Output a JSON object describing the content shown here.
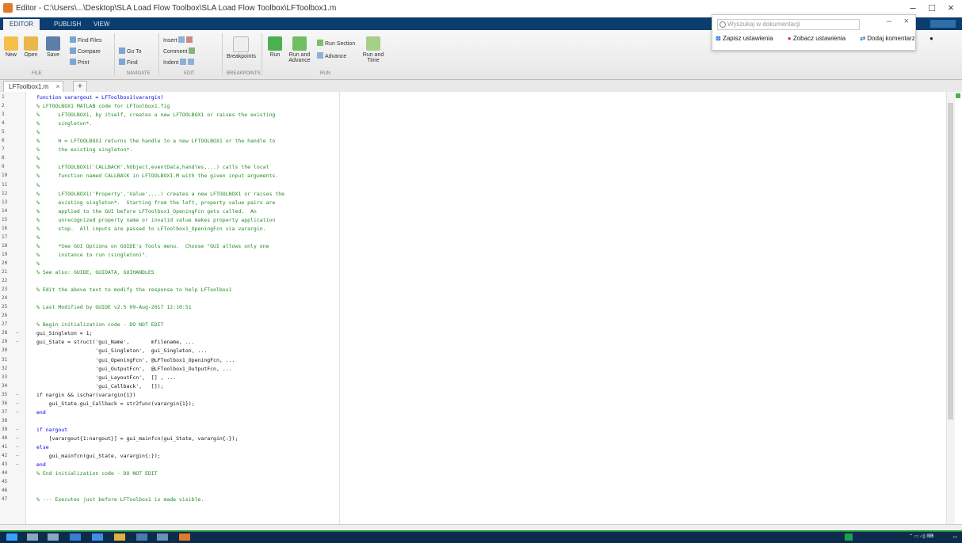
{
  "window": {
    "title": "Editor - C:\\Users\\...\\Desktop\\SLA Load Flow Toolbox\\SLA Load Flow Toolbox\\LFToolbox1.m"
  },
  "popup": {
    "search_placeholder": "Wyszukaj w dokumentacji",
    "items": [
      "Zapisz ustawienia",
      "Zobacz ustawienia",
      "Dodaj komentarz"
    ]
  },
  "ribbon": {
    "tabs": [
      "EDITOR",
      "PUBLISH",
      "VIEW"
    ],
    "new": "New",
    "open": "Open",
    "save": "Save",
    "find_files": "Find Files",
    "compare": "Compare",
    "print": "Print",
    "insert": "Insert",
    "comment": "Comment",
    "indent": "Indent",
    "go_to": "Go To",
    "find": "Find",
    "breakpoints": "Breakpoints",
    "run": "Run",
    "run_and_advance": "Run and Advance",
    "run_section": "Run Section",
    "advance": "Advance",
    "run_and_time": "Run and Time",
    "sections": [
      "FILE",
      "NAVIGATE",
      "EDIT",
      "BREAKPOINTS",
      "RUN"
    ]
  },
  "file_tab": {
    "name": "LFToolbox1.m",
    "close": "×",
    "add": "+"
  },
  "editor": {
    "lines": [
      {
        "n": "1",
        "mk": "",
        "cls": "kw",
        "text": "function varargout = LFToolbox1(varargin)"
      },
      {
        "n": "2",
        "mk": "",
        "cls": "cm",
        "text": "% LFTOOLBOX1 MATLAB code for LFToolbox1.fig"
      },
      {
        "n": "3",
        "mk": "",
        "cls": "cm",
        "text": "%      LFTOOLBOX1, by itself, creates a new LFTOOLBOX1 or raises the existing"
      },
      {
        "n": "4",
        "mk": "",
        "cls": "cm",
        "text": "%      singleton*."
      },
      {
        "n": "5",
        "mk": "",
        "cls": "cm",
        "text": "%"
      },
      {
        "n": "6",
        "mk": "",
        "cls": "cm",
        "text": "%      H = LFTOOLBOX1 returns the handle to a new LFTOOLBOX1 or the handle to"
      },
      {
        "n": "7",
        "mk": "",
        "cls": "cm",
        "text": "%      the existing singleton*."
      },
      {
        "n": "8",
        "mk": "",
        "cls": "cm",
        "text": "%"
      },
      {
        "n": "9",
        "mk": "",
        "cls": "cm",
        "text": "%      LFTOOLBOX1('CALLBACK',hObject,eventData,handles,...) calls the local"
      },
      {
        "n": "10",
        "mk": "",
        "cls": "cm",
        "text": "%      function named CALLBACK in LFTOOLBOX1.M with the given input arguments."
      },
      {
        "n": "11",
        "mk": "",
        "cls": "cm",
        "text": "%"
      },
      {
        "n": "12",
        "mk": "",
        "cls": "cm",
        "text": "%      LFTOOLBOX1('Property','Value',...) creates a new LFTOOLBOX1 or raises the"
      },
      {
        "n": "13",
        "mk": "",
        "cls": "cm",
        "text": "%      existing singleton*.  Starting from the left, property value pairs are"
      },
      {
        "n": "14",
        "mk": "",
        "cls": "cm",
        "text": "%      applied to the GUI before LFToolbox1_OpeningFcn gets called.  An"
      },
      {
        "n": "15",
        "mk": "",
        "cls": "cm",
        "text": "%      unrecognized property name or invalid value makes property application"
      },
      {
        "n": "16",
        "mk": "",
        "cls": "cm",
        "text": "%      stop.  All inputs are passed to LFToolbox1_OpeningFcn via varargin."
      },
      {
        "n": "17",
        "mk": "",
        "cls": "cm",
        "text": "%"
      },
      {
        "n": "18",
        "mk": "",
        "cls": "cm",
        "text": "%      *See GUI Options on GUIDE's Tools menu.  Choose \"GUI allows only one"
      },
      {
        "n": "19",
        "mk": "",
        "cls": "cm",
        "text": "%      instance to run (singleton)\"."
      },
      {
        "n": "20",
        "mk": "",
        "cls": "cm",
        "text": "%"
      },
      {
        "n": "21",
        "mk": "",
        "cls": "cm",
        "text": "% See also: GUIDE, GUIDATA, GUIHANDLES"
      },
      {
        "n": "22",
        "mk": "",
        "cls": "pl",
        "text": ""
      },
      {
        "n": "23",
        "mk": "",
        "cls": "cm",
        "text": "% Edit the above text to modify the response to help LFToolbox1"
      },
      {
        "n": "24",
        "mk": "",
        "cls": "pl",
        "text": ""
      },
      {
        "n": "25",
        "mk": "",
        "cls": "cm",
        "text": "% Last Modified by GUIDE v2.5 09-Aug-2017 12:10:51"
      },
      {
        "n": "26",
        "mk": "",
        "cls": "pl",
        "text": ""
      },
      {
        "n": "27",
        "mk": "",
        "cls": "cm",
        "text": "% Begin initialization code - DO NOT EDIT"
      },
      {
        "n": "28",
        "mk": "–",
        "cls": "pl",
        "text": "gui_Singleton = 1;"
      },
      {
        "n": "29",
        "mk": "–",
        "cls": "pl",
        "text": "gui_State = struct('gui_Name',       mfilename, ..."
      },
      {
        "n": "30",
        "mk": "",
        "cls": "pl",
        "text": "                   'gui_Singleton',  gui_Singleton, ..."
      },
      {
        "n": "31",
        "mk": "",
        "cls": "pl",
        "text": "                   'gui_OpeningFcn', @LFToolbox1_OpeningFcn, ..."
      },
      {
        "n": "32",
        "mk": "",
        "cls": "pl",
        "text": "                   'gui_OutputFcn',  @LFToolbox1_OutputFcn, ..."
      },
      {
        "n": "33",
        "mk": "",
        "cls": "pl",
        "text": "                   'gui_LayoutFcn',  [] , ..."
      },
      {
        "n": "34",
        "mk": "",
        "cls": "pl",
        "text": "                   'gui_Callback',   []);"
      },
      {
        "n": "35",
        "mk": "–",
        "cls": "pl",
        "text": "if nargin && ischar(varargin{1})"
      },
      {
        "n": "36",
        "mk": "–",
        "cls": "pl",
        "text": "    gui_State.gui_Callback = str2func(varargin{1});"
      },
      {
        "n": "37",
        "mk": "–",
        "cls": "kw",
        "text": "end"
      },
      {
        "n": "38",
        "mk": "",
        "cls": "pl",
        "text": ""
      },
      {
        "n": "39",
        "mk": "–",
        "cls": "kw",
        "text": "if nargout"
      },
      {
        "n": "40",
        "mk": "–",
        "cls": "pl",
        "text": "    [varargout{1:nargout}] = gui_mainfcn(gui_State, varargin{:});"
      },
      {
        "n": "41",
        "mk": "–",
        "cls": "kw",
        "text": "else"
      },
      {
        "n": "42",
        "mk": "–",
        "cls": "pl",
        "text": "    gui_mainfcn(gui_State, varargin{:});"
      },
      {
        "n": "43",
        "mk": "–",
        "cls": "kw",
        "text": "end"
      },
      {
        "n": "44",
        "mk": "",
        "cls": "cm",
        "text": "% End initialization code - DO NOT EDIT"
      },
      {
        "n": "45",
        "mk": "",
        "cls": "pl",
        "text": ""
      },
      {
        "n": "46",
        "mk": "",
        "cls": "pl",
        "text": ""
      },
      {
        "n": "47",
        "mk": "",
        "cls": "cm",
        "text": "% --- Executes just before LFToolbox1 is made visible."
      }
    ]
  }
}
